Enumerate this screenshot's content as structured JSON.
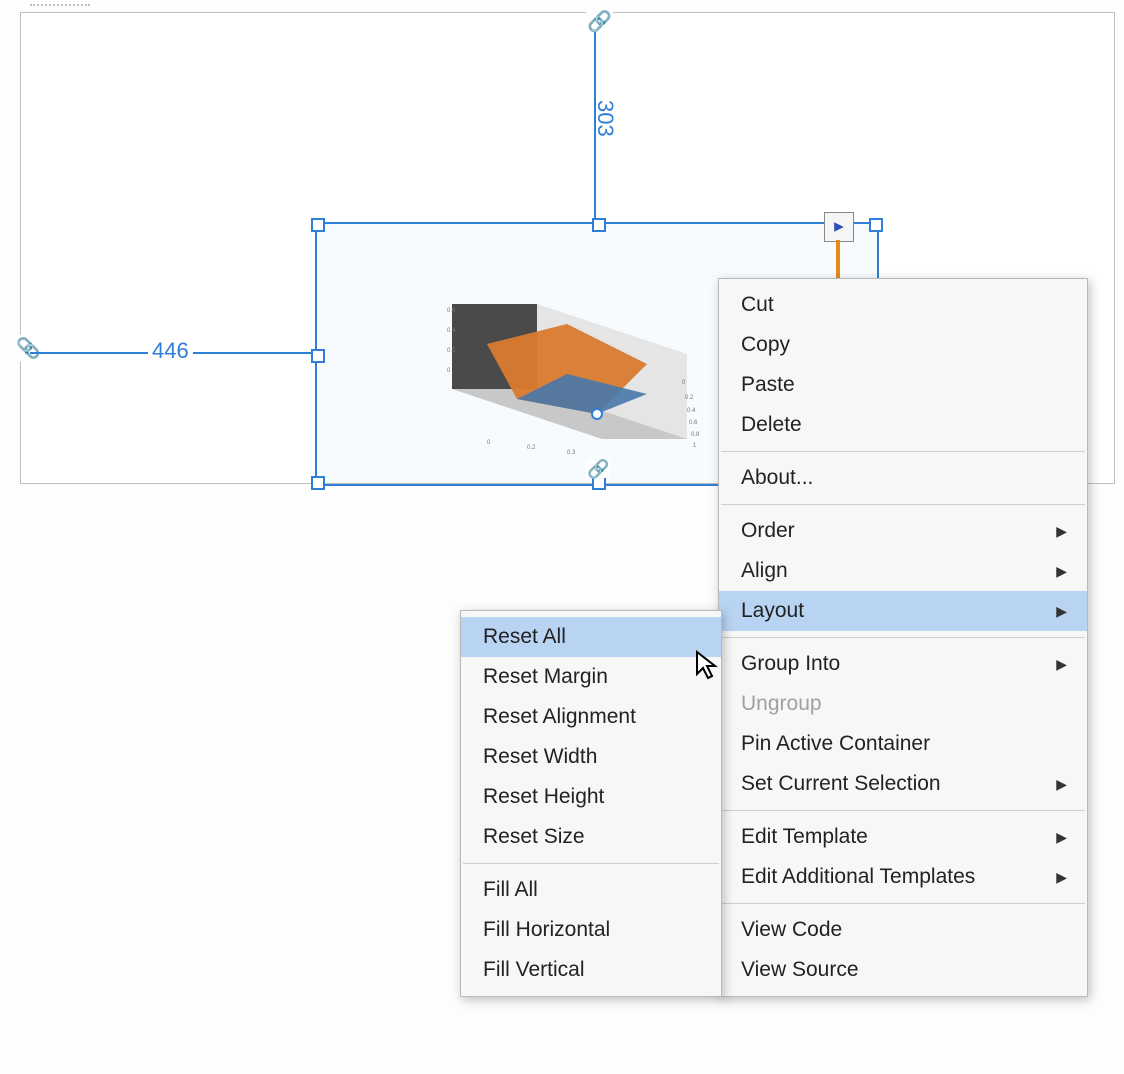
{
  "dimensions": {
    "horizontal": "446",
    "vertical": "303"
  },
  "context_menu": {
    "cut": "Cut",
    "copy": "Copy",
    "paste": "Paste",
    "delete": "Delete",
    "about": "About...",
    "order": "Order",
    "align": "Align",
    "layout": "Layout",
    "group_into": "Group Into",
    "ungroup": "Ungroup",
    "pin_active_container": "Pin Active Container",
    "set_current_selection": "Set Current Selection",
    "edit_template": "Edit Template",
    "edit_additional_templates": "Edit Additional Templates",
    "view_code": "View Code",
    "view_source": "View Source"
  },
  "layout_submenu": {
    "reset_all": "Reset All",
    "reset_margin": "Reset Margin",
    "reset_alignment": "Reset Alignment",
    "reset_width": "Reset Width",
    "reset_height": "Reset Height",
    "reset_size": "Reset Size",
    "fill_all": "Fill All",
    "fill_horizontal": "Fill Horizontal",
    "fill_vertical": "Fill Vertical"
  },
  "plot": {
    "y_ticks": [
      "0.6",
      "0.4",
      "0.2",
      "0"
    ],
    "x1_ticks": [
      "0",
      "0.2",
      "0.3"
    ],
    "x2_ticks": [
      "0",
      "0.2",
      "0.4",
      "0.6",
      "0.8",
      "1"
    ]
  }
}
